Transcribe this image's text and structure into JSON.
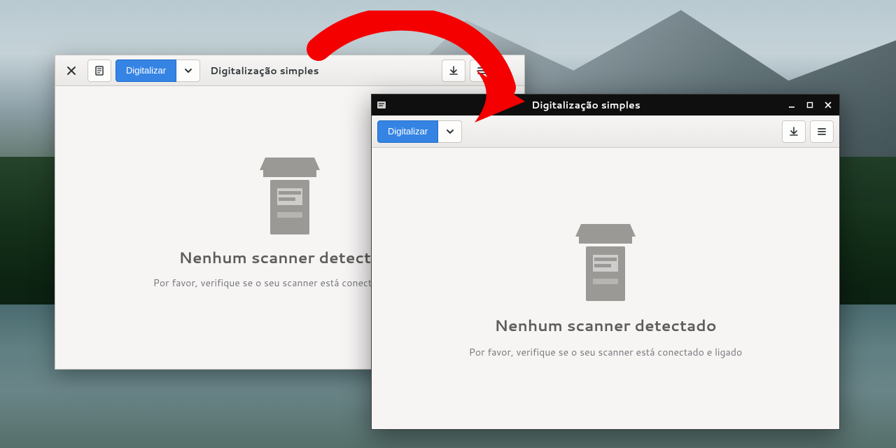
{
  "window1": {
    "title": "Digitalização simples",
    "scan_button": "Digitalizar",
    "empty_state": {
      "title": "Nenhum scanner detectado",
      "subtitle": "Por favor, verifique se o seu scanner está conectado e ligado"
    }
  },
  "window2": {
    "title": "Digitalização simples",
    "scan_button": "Digitalizar",
    "empty_state": {
      "title": "Nenhum scanner detectado",
      "subtitle": "Por favor, verifique se o seu scanner está conectado e ligado"
    }
  },
  "colors": {
    "accent": "#3584e4"
  }
}
